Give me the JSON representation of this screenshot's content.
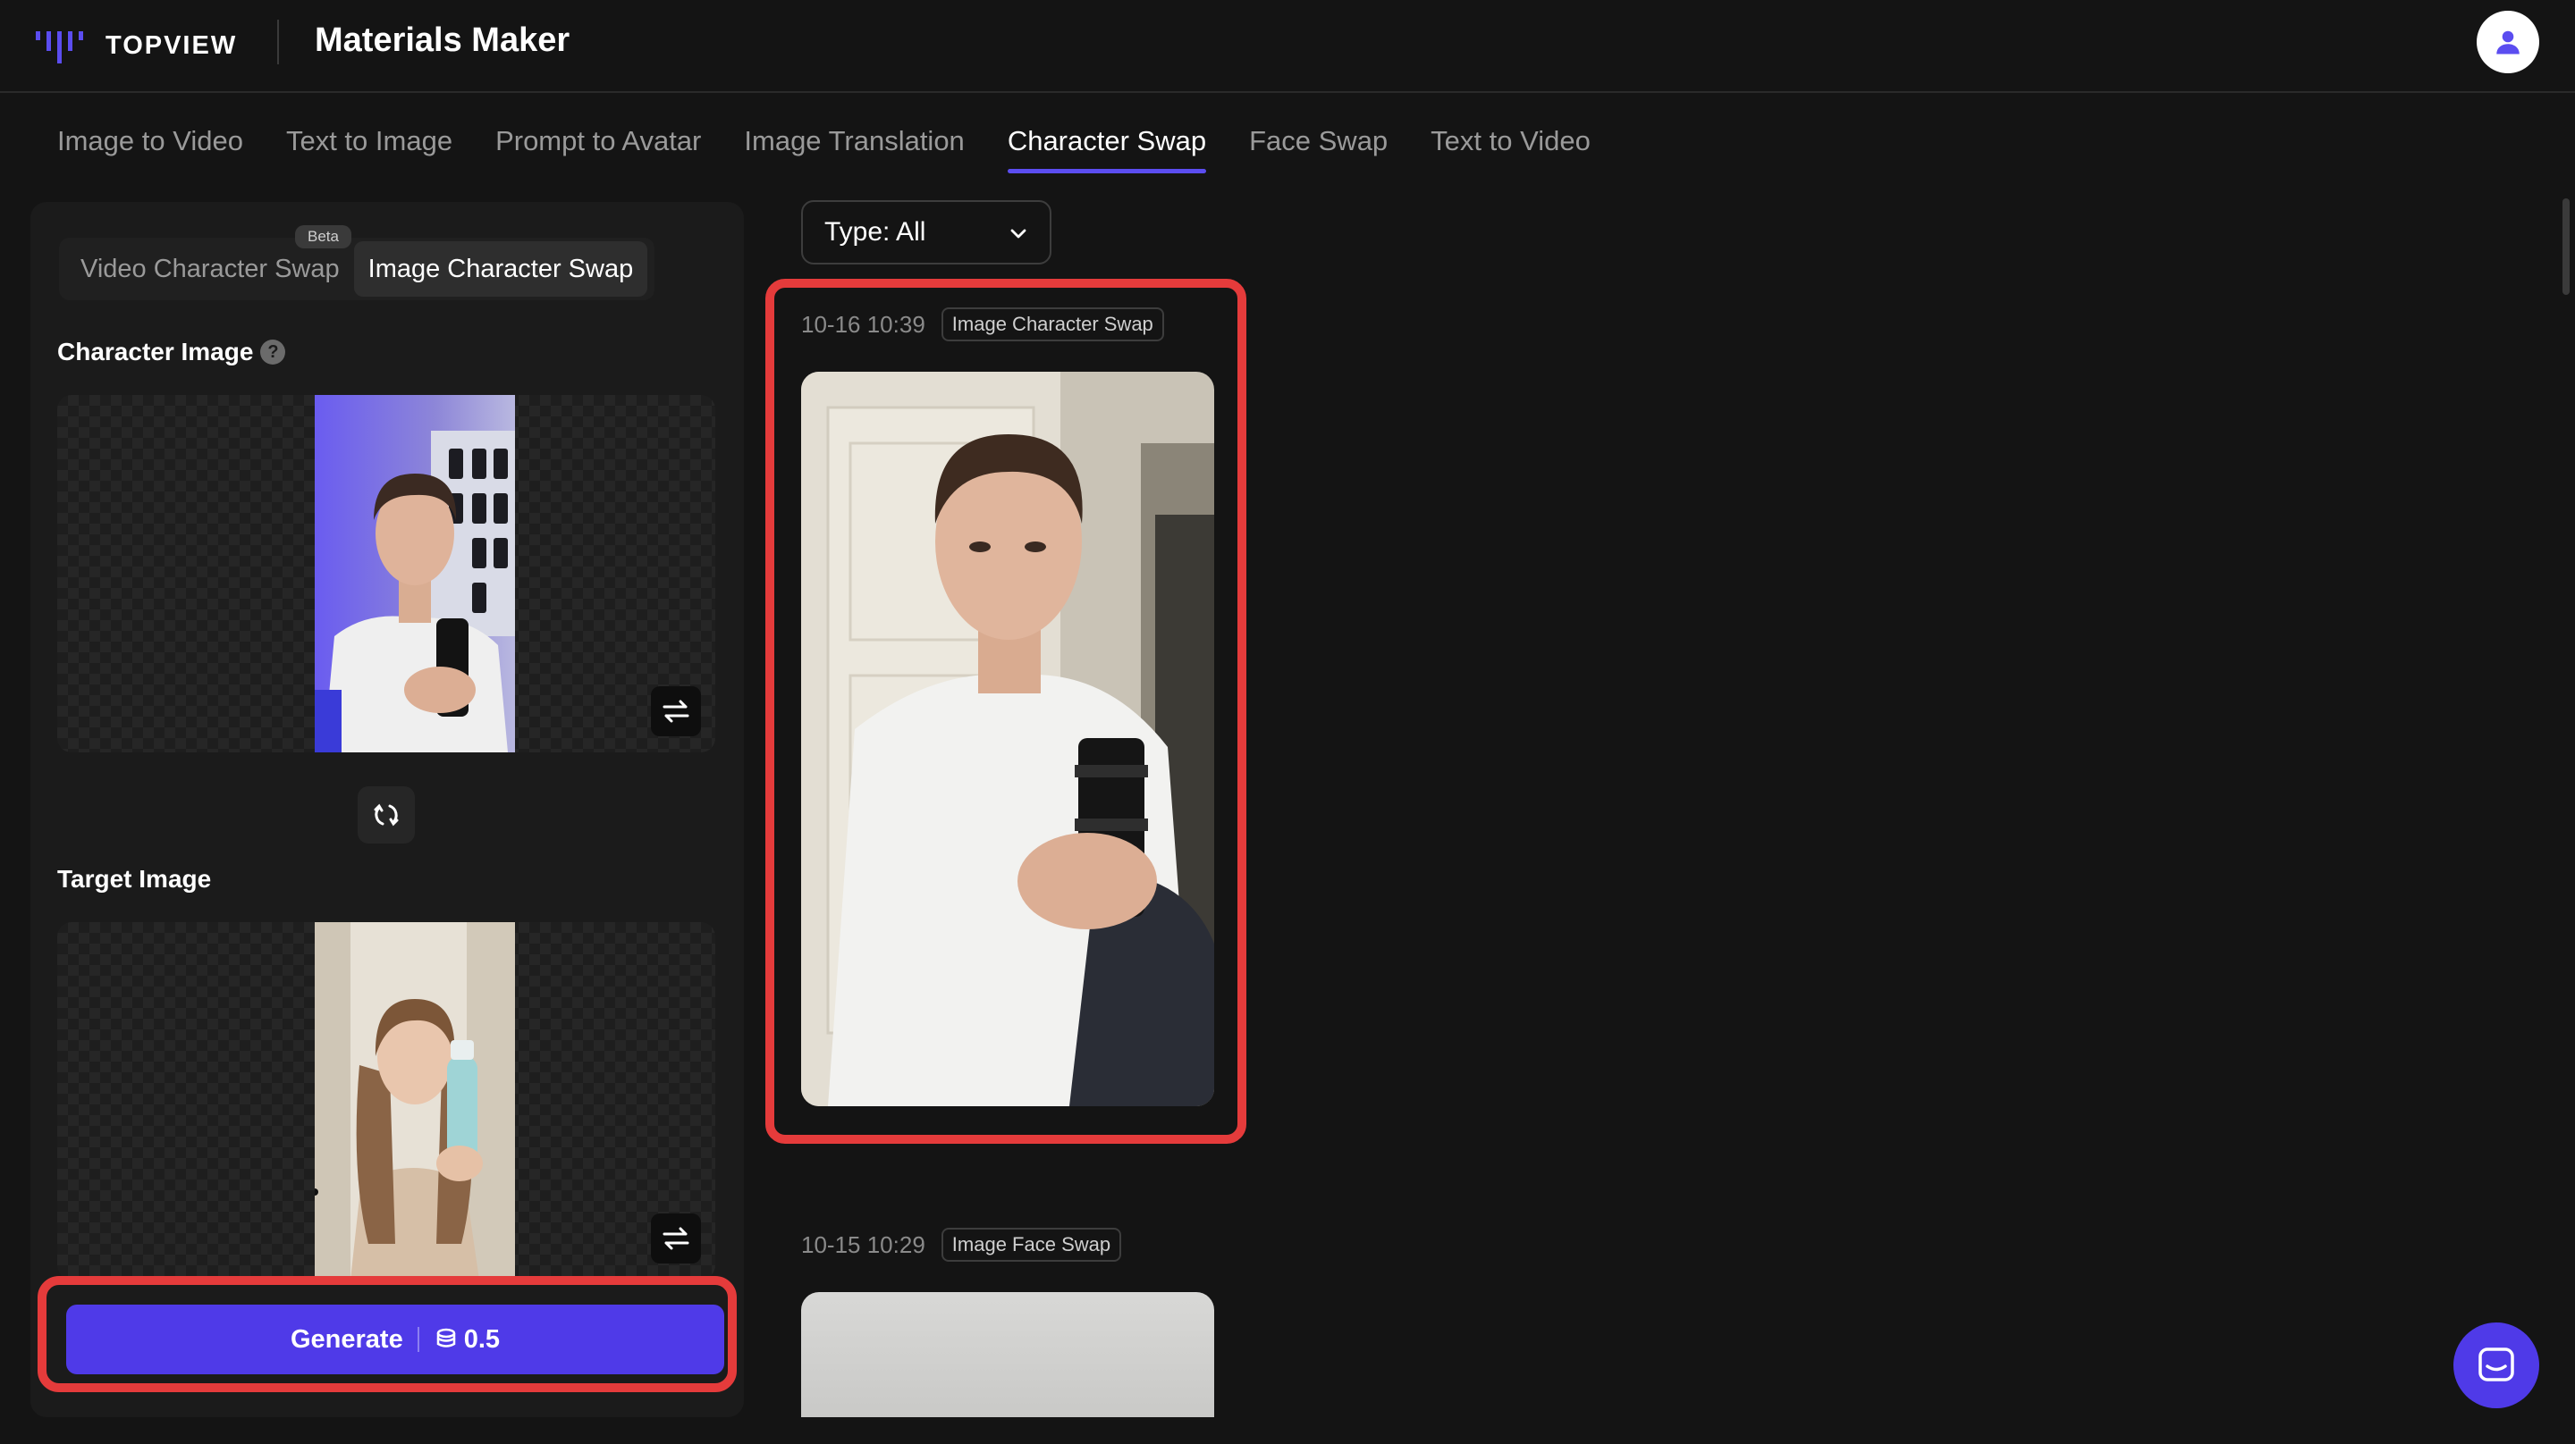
{
  "header": {
    "brand": "TOPVIEW",
    "app_title": "Materials Maker",
    "avatar_icon": "user-icon"
  },
  "tabs": [
    {
      "label": "Image to Video",
      "active": false
    },
    {
      "label": "Text to Image",
      "active": false
    },
    {
      "label": "Prompt to Avatar",
      "active": false
    },
    {
      "label": "Image Translation",
      "active": false
    },
    {
      "label": "Character Swap",
      "active": true
    },
    {
      "label": "Face Swap",
      "active": false
    },
    {
      "label": "Text to Video",
      "active": false
    }
  ],
  "panel": {
    "subtabs": [
      {
        "label": "Video Character Swap",
        "active": false
      },
      {
        "label": "Image Character Swap",
        "active": true
      }
    ],
    "beta_badge": "Beta",
    "character_label": "Character Image",
    "target_label": "Target Image",
    "generate_label": "Generate",
    "generate_cost": "0.5"
  },
  "filter": {
    "type_label": "Type: All"
  },
  "results": [
    {
      "time": "10-16 10:39",
      "tag": "Image Character Swap"
    },
    {
      "time": "10-15 10:29",
      "tag": "Image Face Swap"
    }
  ],
  "colors": {
    "accent": "#4f3ae8",
    "highlight": "#e53b3b",
    "background": "#141414",
    "panel": "#1b1b1b"
  }
}
